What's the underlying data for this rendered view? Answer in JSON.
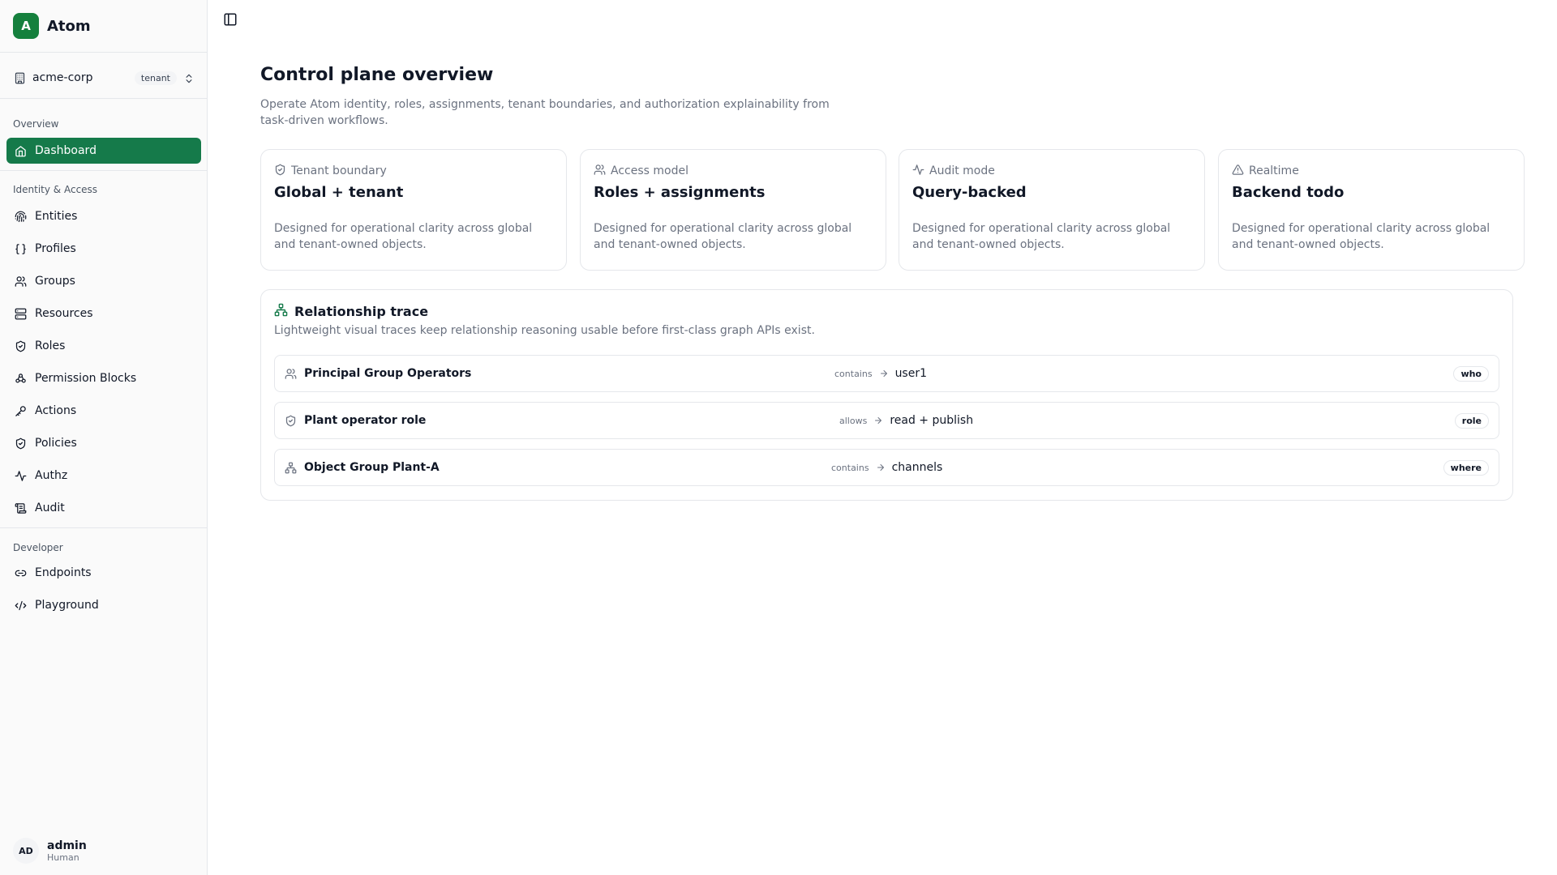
{
  "app": {
    "name": "Atom",
    "logo_letter": "A",
    "brand_color": "#157a4a"
  },
  "tenant": {
    "name": "acme-corp",
    "badge": "tenant"
  },
  "sidebar": {
    "sections": {
      "overview": "Overview",
      "identity": "Identity & Access",
      "developer": "Developer"
    },
    "items": [
      {
        "label": "Dashboard",
        "icon": "home-icon",
        "active": true
      },
      {
        "label": "Entities",
        "icon": "fingerprint-icon"
      },
      {
        "label": "Profiles",
        "icon": "braces-icon"
      },
      {
        "label": "Groups",
        "icon": "users-icon"
      },
      {
        "label": "Resources",
        "icon": "server-icon"
      },
      {
        "label": "Roles",
        "icon": "shield-icon"
      },
      {
        "label": "Permission Blocks",
        "icon": "blocks-icon"
      },
      {
        "label": "Actions",
        "icon": "key-icon"
      },
      {
        "label": "Policies",
        "icon": "shield-icon"
      },
      {
        "label": "Authz",
        "icon": "activity-icon"
      },
      {
        "label": "Audit",
        "icon": "scroll-icon"
      },
      {
        "label": "Endpoints",
        "icon": "link-icon"
      },
      {
        "label": "Playground",
        "icon": "code-icon"
      }
    ]
  },
  "user": {
    "initials": "AD",
    "name": "admin",
    "role": "Human"
  },
  "main": {
    "title": "Control plane overview",
    "description": "Operate Atom identity, roles, assignments, tenant boundaries, and authorization explainability from task-driven workflows.",
    "cards": [
      {
        "label": "Tenant boundary",
        "icon": "shield-icon",
        "value": "Global + tenant",
        "desc": "Designed for operational clarity across global and tenant-owned objects."
      },
      {
        "label": "Access model",
        "icon": "users-icon",
        "value": "Roles + assignments",
        "desc": "Designed for operational clarity across global and tenant-owned objects."
      },
      {
        "label": "Audit mode",
        "icon": "activity-icon",
        "value": "Query-backed",
        "desc": "Designed for operational clarity across global and tenant-owned objects."
      },
      {
        "label": "Realtime",
        "icon": "warning-icon",
        "value": "Backend todo",
        "desc": "Designed for operational clarity across global and tenant-owned objects."
      }
    ],
    "trace": {
      "title": "Relationship trace",
      "description": "Lightweight visual traces keep relationship reasoning usable before first-class graph APIs exist.",
      "rows": [
        {
          "icon": "users-icon",
          "source": "Principal Group Operators",
          "relation": "contains",
          "target": "user1",
          "tag": "who"
        },
        {
          "icon": "shield-icon",
          "source": "Plant operator role",
          "relation": "allows",
          "target": "read + publish",
          "tag": "role"
        },
        {
          "icon": "network-icon",
          "source": "Object Group Plant-A",
          "relation": "contains",
          "target": "channels",
          "tag": "where"
        }
      ]
    }
  }
}
